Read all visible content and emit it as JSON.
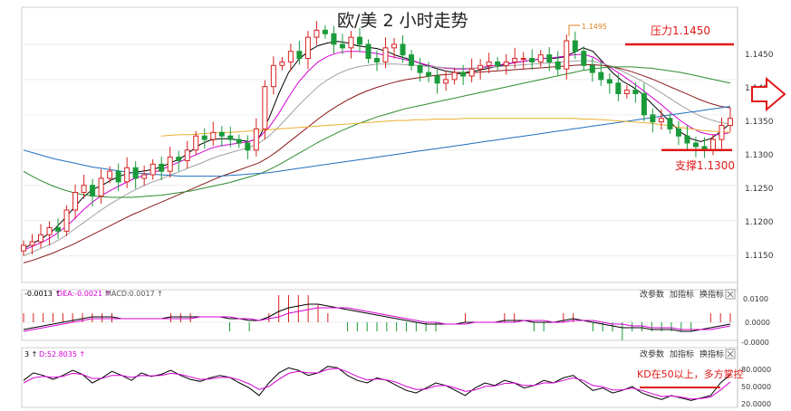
{
  "chart_data": {
    "type": "candlestick",
    "title": "欧/美 2 小时走势",
    "main_panel": {
      "ylim": [
        1.112,
        1.15
      ],
      "y_ticks": [
        "1.1450",
        "1.1400",
        "1.1350",
        "1.1300",
        "1.1250",
        "1.1200",
        "1.1150"
      ],
      "peak_label": "1.1495",
      "resistance": {
        "label": "压力1.1450",
        "value": 1.145
      },
      "support": {
        "label": "支撑1.1300",
        "value": 1.13
      },
      "closes": [
        1.1165,
        1.117,
        1.118,
        1.119,
        1.1185,
        1.1215,
        1.124,
        1.125,
        1.1235,
        1.126,
        1.127,
        1.1255,
        1.1275,
        1.126,
        1.1265,
        1.128,
        1.127,
        1.129,
        1.1285,
        1.13,
        1.132,
        1.1315,
        1.1325,
        1.132,
        1.1315,
        1.131,
        1.13,
        1.133,
        1.139,
        1.142,
        1.1425,
        1.144,
        1.143,
        1.146,
        1.147,
        1.1465,
        1.145,
        1.1445,
        1.146,
        1.145,
        1.143,
        1.1425,
        1.1445,
        1.145,
        1.1435,
        1.142,
        1.141,
        1.1405,
        1.1395,
        1.14,
        1.141,
        1.1405,
        1.1415,
        1.142,
        1.1425,
        1.142,
        1.1425,
        1.143,
        1.143,
        1.1425,
        1.1435,
        1.1425,
        1.1415,
        1.1455,
        1.144,
        1.142,
        1.141,
        1.14,
        1.1395,
        1.138,
        1.1385,
        1.138,
        1.135,
        1.134,
        1.1345,
        1.133,
        1.132,
        1.131,
        1.1305,
        1.13,
        1.1315,
        1.1335,
        1.1345
      ],
      "ma_series": [
        {
          "color": "#000000",
          "values": [
            1.116,
            1.1168,
            1.1176,
            1.1186,
            1.12,
            1.1216,
            1.1232,
            1.1244,
            1.125,
            1.1258,
            1.1264,
            1.1268,
            1.127,
            1.1272,
            1.1276,
            1.1282,
            1.1288,
            1.1298,
            1.1308,
            1.1314,
            1.1316,
            1.1316,
            1.1314,
            1.1312,
            1.1318,
            1.1345,
            1.138,
            1.141,
            1.1428,
            1.144,
            1.1448,
            1.1452,
            1.1454,
            1.1452,
            1.1448,
            1.1446,
            1.1444,
            1.144,
            1.1434,
            1.143,
            1.1425,
            1.142,
            1.1416,
            1.1412,
            1.141,
            1.141,
            1.1412,
            1.1415,
            1.1418,
            1.1421,
            1.1424,
            1.1426,
            1.1428,
            1.143,
            1.143,
            1.1432,
            1.1438,
            1.1445,
            1.144,
            1.1425,
            1.141,
            1.1398,
            1.139,
            1.138,
            1.1366,
            1.1352,
            1.1338,
            1.1325,
            1.1316,
            1.1312,
            1.1316,
            1.1326,
            1.1338
          ]
        },
        {
          "color": "#d400d4",
          "values": [
            1.1158,
            1.1164,
            1.117,
            1.1178,
            1.1188,
            1.12,
            1.1214,
            1.1226,
            1.1236,
            1.1244,
            1.1251,
            1.1258,
            1.1263,
            1.1267,
            1.1272,
            1.1278,
            1.1284,
            1.129,
            1.1296,
            1.1302,
            1.1306,
            1.1308,
            1.131,
            1.1312,
            1.1318,
            1.1332,
            1.1352,
            1.1375,
            1.1396,
            1.1412,
            1.1425,
            1.1433,
            1.1438,
            1.144,
            1.144,
            1.1439,
            1.1437,
            1.1434,
            1.1431,
            1.1428,
            1.1425,
            1.1421,
            1.1418,
            1.1416,
            1.1415,
            1.1415,
            1.1416,
            1.1418,
            1.142,
            1.1422,
            1.1424,
            1.1426,
            1.1428,
            1.143,
            1.1431,
            1.1433,
            1.1435,
            1.1436,
            1.1432,
            1.1424,
            1.1415,
            1.1406,
            1.1396,
            1.1386,
            1.1375,
            1.1364,
            1.1352,
            1.1341,
            1.1332,
            1.1325,
            1.1322,
            1.1322,
            1.1325
          ]
        },
        {
          "color": "#a0a0a0",
          "values": [
            1.115,
            1.1156,
            1.1162,
            1.1168,
            1.1176,
            1.1186,
            1.1196,
            1.1206,
            1.1216,
            1.1225,
            1.1233,
            1.1241,
            1.1248,
            1.1254,
            1.1259,
            1.1265,
            1.127,
            1.1276,
            1.1281,
            1.1287,
            1.1292,
            1.1296,
            1.13,
            1.1304,
            1.131,
            1.132,
            1.1333,
            1.1348,
            1.1363,
            1.1377,
            1.139,
            1.14,
            1.1408,
            1.1414,
            1.1418,
            1.142,
            1.1422,
            1.1422,
            1.1422,
            1.1421,
            1.142,
            1.1419,
            1.1418,
            1.1417,
            1.1416,
            1.1416,
            1.1416,
            1.1417,
            1.1418,
            1.1419,
            1.142,
            1.1421,
            1.1422,
            1.1423,
            1.1424,
            1.1425,
            1.1426,
            1.1427,
            1.1426,
            1.1423,
            1.1418,
            1.1412,
            1.1405,
            1.1398,
            1.139,
            1.1381,
            1.1372,
            1.1363,
            1.1355,
            1.1348,
            1.1343,
            1.1339,
            1.1337
          ]
        },
        {
          "color": "#8b1a1a",
          "values": [
            1.114,
            1.1144,
            1.1149,
            1.1154,
            1.116,
            1.1166,
            1.1173,
            1.118,
            1.1187,
            1.1194,
            1.1201,
            1.1208,
            1.1214,
            1.122,
            1.1226,
            1.1232,
            1.1238,
            1.1244,
            1.125,
            1.1256,
            1.1262,
            1.1267,
            1.1272,
            1.1277,
            1.1282,
            1.129,
            1.13,
            1.1311,
            1.1322,
            1.1333,
            1.1344,
            1.1354,
            1.1363,
            1.1371,
            1.1378,
            1.1384,
            1.1389,
            1.1393,
            1.1397,
            1.14,
            1.1402,
            1.1404,
            1.1406,
            1.1407,
            1.1408,
            1.1409,
            1.141,
            1.1411,
            1.1412,
            1.1413,
            1.1414,
            1.1415,
            1.1416,
            1.1417,
            1.1418,
            1.1419,
            1.142,
            1.1421,
            1.1421,
            1.142,
            1.1418,
            1.1415,
            1.1411,
            1.1406,
            1.1401,
            1.1395,
            1.1389,
            1.1383,
            1.1377,
            1.1371,
            1.1366,
            1.1362,
            1.136
          ]
        },
        {
          "color": "#2e8b2e",
          "values": [
            1.127,
            1.1262,
            1.1255,
            1.1249,
            1.1244,
            1.124,
            1.1237,
            1.1235,
            1.1234,
            1.1233,
            1.1233,
            1.1233,
            1.1234,
            1.1235,
            1.1236,
            1.1238,
            1.124,
            1.1242,
            1.1245,
            1.1248,
            1.1251,
            1.1254,
            1.1258,
            1.1262,
            1.1266,
            1.1272,
            1.1279,
            1.1287,
            1.1295,
            1.1303,
            1.1311,
            1.1318,
            1.1325,
            1.1331,
            1.1337,
            1.1342,
            1.1347,
            1.1351,
            1.1355,
            1.1359,
            1.1362,
            1.1365,
            1.1368,
            1.1371,
            1.1374,
            1.1377,
            1.138,
            1.1383,
            1.1386,
            1.1389,
            1.1392,
            1.1395,
            1.1398,
            1.1401,
            1.1404,
            1.1407,
            1.141,
            1.1413,
            1.1415,
            1.1417,
            1.1418,
            1.1418,
            1.1418,
            1.1417,
            1.1416,
            1.1414,
            1.1412,
            1.141,
            1.1407,
            1.1404,
            1.1401,
            1.1398,
            1.1395
          ]
        },
        {
          "color": "#1f6fbf",
          "values": [
            1.13,
            1.1296,
            1.1292,
            1.1288,
            1.1285,
            1.1282,
            1.1279,
            1.1276,
            1.1274,
            1.1272,
            1.127,
            1.1268,
            1.1267,
            1.1266,
            1.1265,
            1.1264,
            1.1263,
            1.1263,
            1.1263,
            1.1263,
            1.1263,
            1.1264,
            1.1265,
            1.1266,
            1.1267,
            1.1268,
            1.127,
            1.1272,
            1.1274,
            1.1276,
            1.1278,
            1.128,
            1.1282,
            1.1284,
            1.1286,
            1.1288,
            1.129,
            1.1292,
            1.1294,
            1.1296,
            1.1298,
            1.13,
            1.1302,
            1.1304,
            1.1306,
            1.1308,
            1.131,
            1.1312,
            1.1314,
            1.1316,
            1.1318,
            1.132,
            1.1322,
            1.1324,
            1.1326,
            1.1328,
            1.133,
            1.1332,
            1.1334,
            1.1336,
            1.1338,
            1.134,
            1.1342,
            1.1344,
            1.1346,
            1.1348,
            1.135,
            1.1352,
            1.1354,
            1.1356,
            1.1358,
            1.136,
            1.1362
          ]
        },
        {
          "color": "#e8b030",
          "values": [
            null,
            null,
            null,
            null,
            null,
            null,
            null,
            null,
            null,
            null,
            null,
            null,
            null,
            null,
            1.132,
            1.1321,
            1.1322,
            1.1322,
            1.1323,
            1.1324,
            1.1325,
            1.1325,
            1.1326,
            1.1327,
            1.1328,
            1.1329,
            1.133,
            1.1331,
            1.1332,
            1.1333,
            1.1334,
            1.1335,
            1.1336,
            1.1337,
            1.1338,
            1.1339,
            1.134,
            1.1341,
            1.1342,
            1.1342,
            1.1343,
            1.1343,
            1.1344,
            1.1344,
            1.1344,
            1.1345,
            1.1345,
            1.1345,
            1.1345,
            1.1345,
            1.1345,
            1.1345,
            1.1345,
            1.1345,
            1.1345,
            1.1345,
            1.1345,
            1.1344,
            1.1344,
            1.1343,
            1.1342,
            1.1341,
            1.134,
            1.1339,
            1.1338,
            1.1336,
            1.1334,
            1.1332,
            1.133,
            1.1328,
            1.1327,
            1.1326,
            1.1325
          ]
        }
      ]
    },
    "macd_panel": {
      "legend": [
        {
          "text": "-0.0013 ↑",
          "color": "#000000"
        },
        {
          "text": "DEA:-0.0021 ↑",
          "color": "#d400d4"
        },
        {
          "text": "MACD:0.0017 ↑",
          "color": "#555555"
        }
      ],
      "y_ticks": [
        "0.0100",
        "0.0000",
        "-0.0000"
      ],
      "controls": [
        "改参数",
        "加指标",
        "换指标"
      ],
      "dif": [
        -0.004,
        -0.003,
        -0.002,
        -0.001,
        0.0,
        0.001,
        0.002,
        0.003,
        0.003,
        0.003,
        0.002,
        0.002,
        0.002,
        0.002,
        0.002,
        0.003,
        0.003,
        0.003,
        0.003,
        0.003,
        0.003,
        0.002,
        0.002,
        0.001,
        0.001,
        0.003,
        0.006,
        0.008,
        0.009,
        0.01,
        0.01,
        0.009,
        0.008,
        0.007,
        0.006,
        0.005,
        0.004,
        0.003,
        0.002,
        0.001,
        0.0,
        -0.001,
        -0.001,
        -0.001,
        -0.001,
        0.0,
        0.0,
        0.0,
        0.0,
        0.001,
        0.001,
        0.001,
        0.0,
        0.0,
        0.0,
        0.001,
        0.002,
        0.001,
        0.0,
        -0.001,
        -0.002,
        -0.003,
        -0.003,
        -0.003,
        -0.004,
        -0.004,
        -0.004,
        -0.005,
        -0.005,
        -0.004,
        -0.003,
        -0.002,
        -0.001
      ],
      "dea": [
        -0.005,
        -0.004,
        -0.003,
        -0.002,
        -0.001,
        0.0,
        0.001,
        0.002,
        0.002,
        0.002,
        0.002,
        0.002,
        0.002,
        0.002,
        0.002,
        0.002,
        0.002,
        0.002,
        0.003,
        0.003,
        0.003,
        0.003,
        0.002,
        0.002,
        0.001,
        0.002,
        0.003,
        0.005,
        0.006,
        0.007,
        0.008,
        0.008,
        0.008,
        0.008,
        0.007,
        0.006,
        0.005,
        0.004,
        0.003,
        0.002,
        0.001,
        0.0,
        0.0,
        -0.001,
        -0.001,
        -0.001,
        0.0,
        0.0,
        0.0,
        0.0,
        0.0,
        0.001,
        0.001,
        0.001,
        0.0,
        0.0,
        0.001,
        0.001,
        0.001,
        0.0,
        -0.001,
        -0.001,
        -0.002,
        -0.002,
        -0.003,
        -0.003,
        -0.003,
        -0.004,
        -0.004,
        -0.004,
        -0.004,
        -0.003,
        -0.002
      ]
    },
    "kd_panel": {
      "legend": [
        {
          "text": "3 ↑",
          "color": "#000000"
        },
        {
          "text": "D:52.8035 ↑",
          "color": "#d400d4"
        }
      ],
      "y_ticks": [
        "80.0000",
        "50.0000",
        "20.0000"
      ],
      "controls": [
        "改参数",
        "加指标",
        "换指标"
      ],
      "annotation": "KD在50以上，多方掌控",
      "k": [
        60,
        75,
        70,
        62,
        70,
        80,
        72,
        55,
        65,
        78,
        70,
        60,
        75,
        68,
        72,
        80,
        70,
        62,
        58,
        65,
        70,
        66,
        55,
        45,
        30,
        55,
        75,
        85,
        80,
        70,
        75,
        88,
        85,
        70,
        60,
        55,
        65,
        60,
        50,
        40,
        35,
        45,
        55,
        50,
        40,
        30,
        45,
        55,
        50,
        60,
        55,
        45,
        50,
        60,
        55,
        65,
        70,
        55,
        40,
        45,
        35,
        40,
        48,
        35,
        28,
        22,
        30,
        25,
        20,
        25,
        30,
        55,
        72
      ],
      "d": [
        55,
        65,
        68,
        66,
        68,
        74,
        72,
        64,
        64,
        70,
        70,
        66,
        70,
        69,
        70,
        74,
        72,
        67,
        62,
        63,
        66,
        66,
        61,
        53,
        42,
        48,
        62,
        74,
        78,
        75,
        75,
        82,
        84,
        77,
        68,
        61,
        63,
        61,
        56,
        48,
        42,
        43,
        49,
        50,
        45,
        38,
        41,
        48,
        49,
        54,
        55,
        50,
        50,
        55,
        55,
        60,
        65,
        60,
        50,
        47,
        41,
        41,
        45,
        40,
        34,
        28,
        29,
        27,
        23,
        24,
        27,
        41,
        57
      ]
    }
  }
}
